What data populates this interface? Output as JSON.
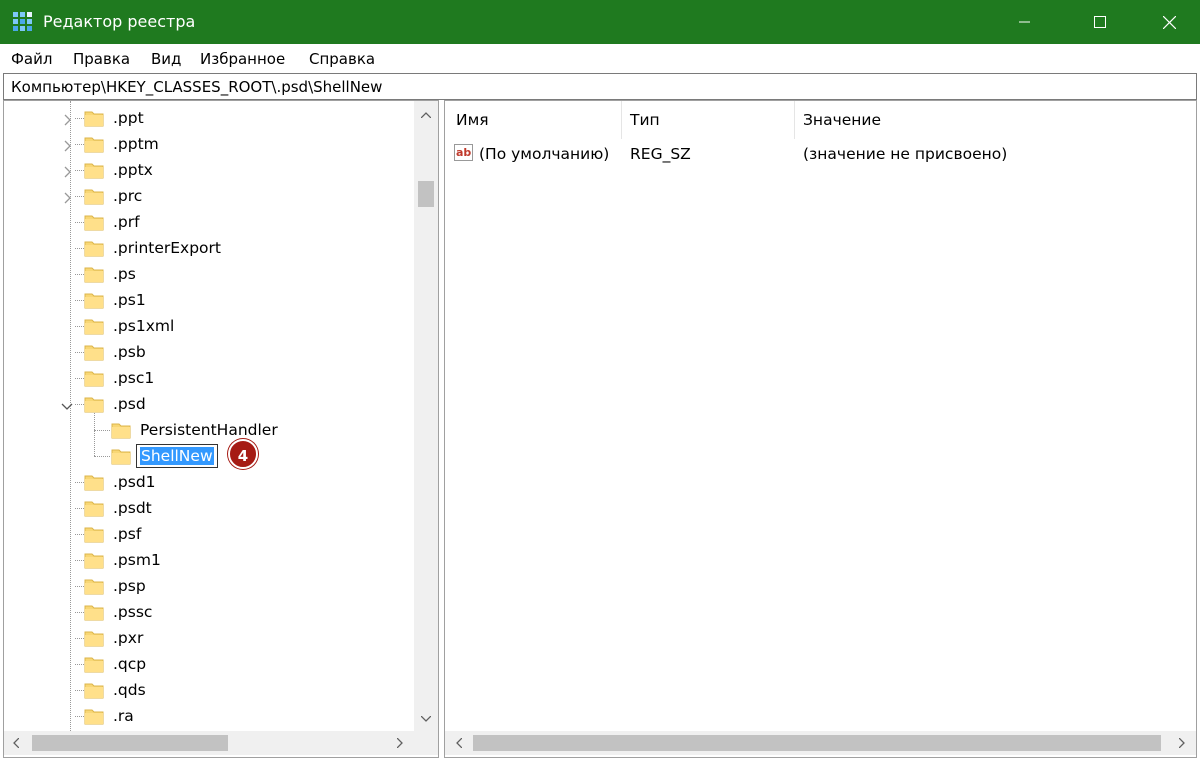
{
  "window": {
    "title": "Редактор реестра",
    "accent": "#1f7a1f"
  },
  "menu": [
    "Файл",
    "Правка",
    "Вид",
    "Избранное",
    "Справка"
  ],
  "address": "Компьютер\\HKEY_CLASSES_ROOT\\.psd\\ShellNew",
  "tree": {
    "items": [
      {
        "label": ".ppt",
        "expandable": true
      },
      {
        "label": ".pptm",
        "expandable": true
      },
      {
        "label": ".pptx",
        "expandable": true
      },
      {
        "label": ".prc",
        "expandable": true
      },
      {
        "label": ".prf",
        "expandable": false
      },
      {
        "label": ".printerExport",
        "expandable": false
      },
      {
        "label": ".ps",
        "expandable": false
      },
      {
        "label": ".ps1",
        "expandable": false
      },
      {
        "label": ".ps1xml",
        "expandable": false
      },
      {
        "label": ".psb",
        "expandable": false
      },
      {
        "label": ".psc1",
        "expandable": false
      },
      {
        "label": ".psd",
        "expandable": true,
        "expanded": true
      },
      {
        "label": "PersistentHandler",
        "child": true
      },
      {
        "label": "ShellNew",
        "child": true,
        "editing": true
      },
      {
        "label": ".psd1",
        "expandable": false
      },
      {
        "label": ".psdt",
        "expandable": false
      },
      {
        "label": ".psf",
        "expandable": false
      },
      {
        "label": ".psm1",
        "expandable": false
      },
      {
        "label": ".psp",
        "expandable": false
      },
      {
        "label": ".pssc",
        "expandable": false
      },
      {
        "label": ".pxr",
        "expandable": false
      },
      {
        "label": ".qcp",
        "expandable": false
      },
      {
        "label": ".qds",
        "expandable": false
      },
      {
        "label": ".ra",
        "expandable": false
      }
    ],
    "step_badge": "4"
  },
  "list": {
    "headers": {
      "name": "Имя",
      "type": "Тип",
      "value": "Значение"
    },
    "rows": [
      {
        "icon": "string-value-icon",
        "name": "(По умолчанию)",
        "type": "REG_SZ",
        "value": "(значение не присвоено)"
      }
    ]
  }
}
